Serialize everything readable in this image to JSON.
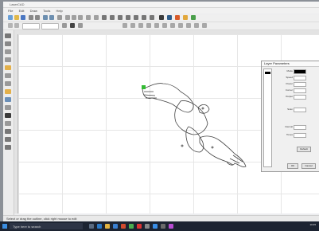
{
  "window": {
    "title": "LaserCAD"
  },
  "menu": {
    "items": [
      "File",
      "Edit",
      "Draw",
      "Tools",
      "Help"
    ]
  },
  "panel": {
    "title": "Layer Parameters",
    "labels": [
      "Mode",
      "Speed",
      "Power",
      "Corner",
      "Output",
      "Scan",
      "Interval",
      "Times"
    ],
    "buttons": [
      "OK",
      "Cancel",
      "Default"
    ]
  },
  "status": {
    "text": "Select or drag the outline, click right mouse to edit"
  },
  "taskbar": {
    "search_placeholder": "Type here to search",
    "time": "10:45"
  },
  "colors": {
    "accent": "#3b8de0",
    "canvas": "#ffffff",
    "taskbar": "#1c2331",
    "start_point": "#33bb33"
  },
  "icons": [
    "new-icon",
    "open-icon",
    "save-icon",
    "undo-icon",
    "zoom-icon",
    "line-icon",
    "circle-icon",
    "text-icon",
    "select-icon"
  ]
}
